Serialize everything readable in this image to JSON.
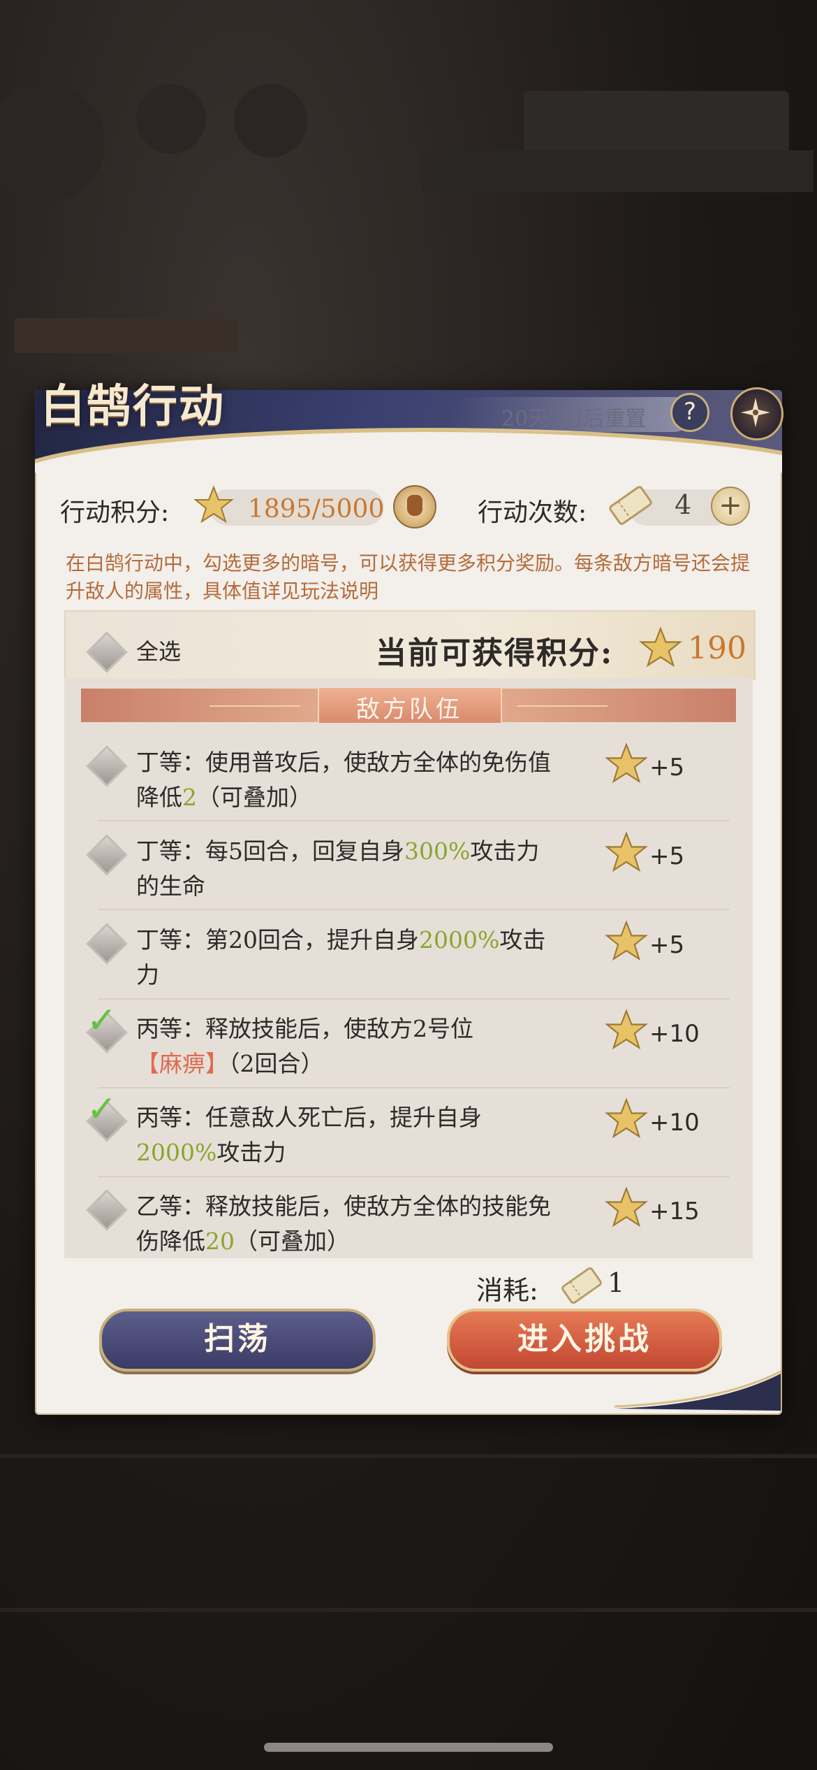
{
  "dialog": {
    "title": "白鹄行动",
    "reset_text": "20天7时后重置",
    "help_label": "?",
    "close_icon": "compass-star-icon"
  },
  "stats": {
    "points_label": "行动积分:",
    "points_value": "1895/5000",
    "count_label": "行动次数:",
    "count_value": "4",
    "plus_label": "+"
  },
  "description": "在白鹄行动中，勾选更多的暗号，可以获得更多积分奖励。每条敌方暗号还会提升敌人的属性，具体值详见玩法说明",
  "select_bar": {
    "select_all_label": "全选",
    "current_points_label": "当前可获得积分:",
    "current_points_value": "190"
  },
  "enemy_section_title": "敌方队伍",
  "items": [
    {
      "segments": [
        "丁等：使用普攻后，使敌方全体的免伤值降低",
        "2",
        "（可叠加）"
      ],
      "points": "+5",
      "checked": false
    },
    {
      "segments": [
        "丁等：每5回合，回复自身",
        "300%",
        "攻击力的生命"
      ],
      "points": "+5",
      "checked": false
    },
    {
      "segments": [
        "丁等：第20回合，提升自身",
        "2000%",
        "攻击力"
      ],
      "points": "+5",
      "checked": false
    },
    {
      "segments": [
        "丙等：释放技能后，使敌方2号位",
        "【麻痹】",
        "（2回合）"
      ],
      "points": "+10",
      "checked": true
    },
    {
      "segments": [
        "丙等：任意敌人死亡后，提升自身",
        "2000%",
        "攻击力"
      ],
      "points": "+10",
      "checked": true
    },
    {
      "segments": [
        "乙等：释放技能后，使敌方全体的技能免伤降低",
        "20",
        "（可叠加）"
      ],
      "points": "+15",
      "checked": false
    }
  ],
  "cost": {
    "label": "消耗:",
    "value": "1"
  },
  "buttons": {
    "sweep": "扫荡",
    "challenge": "进入挑战"
  },
  "colors": {
    "accent_orange": "#c9772f",
    "highlight_green": "#8aa52e",
    "highlight_red": "#e06b50",
    "check_green": "#63c23e"
  }
}
